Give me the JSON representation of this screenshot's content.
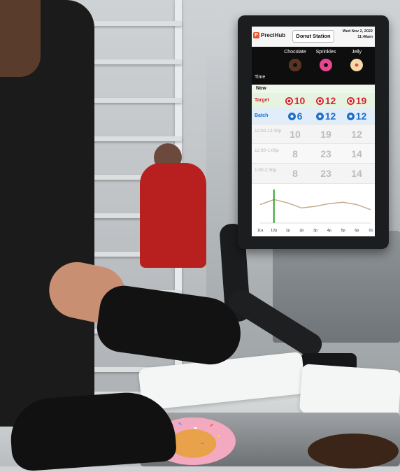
{
  "app": {
    "brand": "PreciHub",
    "station": "Donut Station",
    "date": "Wed Nov 2, 2022",
    "time": "11:46am"
  },
  "columns": [
    {
      "label": "Chocolate",
      "icon": "chocolate-donut-icon",
      "color": "#5a3322"
    },
    {
      "label": "Sprinkles",
      "icon": "pink-sprinkle-donut-icon",
      "color": "#e8478f"
    },
    {
      "label": "Jelly",
      "icon": "jelly-donut-icon",
      "color": "#f0c98a"
    }
  ],
  "labels": {
    "time": "Time",
    "now": "Now",
    "target": "Target",
    "batch": "Batch"
  },
  "target": {
    "values": [
      "10",
      "12",
      "19"
    ],
    "color": "#d7262d",
    "icon": "target-icon"
  },
  "batch": {
    "values": [
      "6",
      "12",
      "12"
    ],
    "color": "#1f6fc7",
    "icon": "donut-batch-icon"
  },
  "slots": [
    {
      "label": "12:00-12:30p",
      "values": [
        "10",
        "19",
        "12"
      ]
    },
    {
      "label": "12:30-1:00p",
      "values": [
        "8",
        "23",
        "14"
      ]
    },
    {
      "label": "1:00-2:30p",
      "values": [
        "8",
        "23",
        "14"
      ]
    }
  ],
  "chart_data": {
    "type": "line",
    "x": [
      "11a",
      "12p",
      "1p",
      "2p",
      "3p",
      "4p",
      "5p",
      "6p",
      "7p"
    ],
    "series": [
      {
        "values": [
          0.55,
          0.7,
          0.6,
          0.45,
          0.5,
          0.58,
          0.62,
          0.55,
          0.4
        ]
      }
    ],
    "current_marker": "12p",
    "colors": {
      "line": "#c7a98c",
      "marker": "#2f9e2f"
    }
  }
}
